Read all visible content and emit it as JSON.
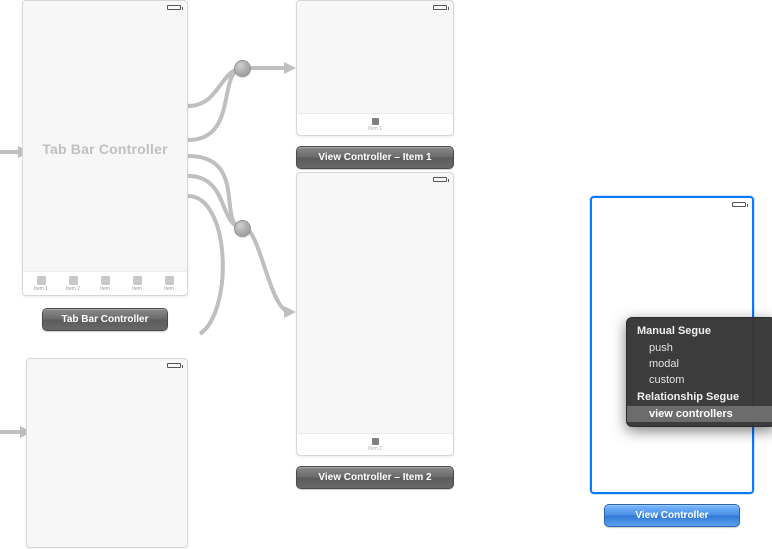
{
  "tab_bar_controller": {
    "center_text": "Tab Bar Controller",
    "caption": "Tab Bar Controller",
    "tab_items": [
      {
        "label": "Item 1"
      },
      {
        "label": "Item 2"
      },
      {
        "label": "Item"
      },
      {
        "label": "Item"
      },
      {
        "label": "Item"
      }
    ]
  },
  "item1": {
    "caption": "View Controller – Item 1",
    "tab_label": "Item 1"
  },
  "item2": {
    "caption": "View Controller – Item 2",
    "tab_label": "Item 2"
  },
  "selected_vc": {
    "caption": "View Controller"
  },
  "segue_menu": {
    "header1": "Manual Segue",
    "items1": [
      "push",
      "modal",
      "custom"
    ],
    "header2": "Relationship Segue",
    "items2": [
      "view controllers"
    ],
    "selected": "view controllers"
  }
}
